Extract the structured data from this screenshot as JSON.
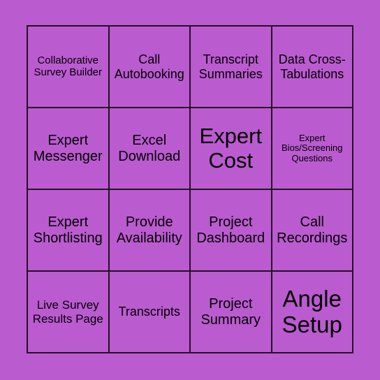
{
  "card": {
    "background_color": "#bb5bd0",
    "cell_color": "#bb5bd0",
    "border_color": "#231023",
    "text_color": "#000000",
    "columns": 4,
    "rows": 4,
    "cells": [
      {
        "text": "Collaborative Survey Builder",
        "size": "fs-sm"
      },
      {
        "text": "Call Autobooking",
        "size": "fs-lg"
      },
      {
        "text": "Transcript Summaries",
        "size": "fs-lg"
      },
      {
        "text": "Data Cross-Tabulations",
        "size": "fs-lg"
      },
      {
        "text": "Expert Messenger",
        "size": "fs-xl"
      },
      {
        "text": "Excel Download",
        "size": "fs-xl"
      },
      {
        "text": "Expert Cost",
        "size": "fs-xxl"
      },
      {
        "text": "Expert Bios/Screening Questions",
        "size": "fs-xs"
      },
      {
        "text": "Expert Shortlisting",
        "size": "fs-xl"
      },
      {
        "text": "Provide Availability",
        "size": "fs-xl"
      },
      {
        "text": "Project Dashboard",
        "size": "fs-xl"
      },
      {
        "text": "Call Recordings",
        "size": "fs-xl"
      },
      {
        "text": "Live Survey Results Page",
        "size": "fs-md"
      },
      {
        "text": "Transcripts",
        "size": "fs-lg"
      },
      {
        "text": "Project Summary",
        "size": "fs-xl"
      },
      {
        "text": "Angle Setup",
        "size": "fs-max"
      }
    ]
  }
}
